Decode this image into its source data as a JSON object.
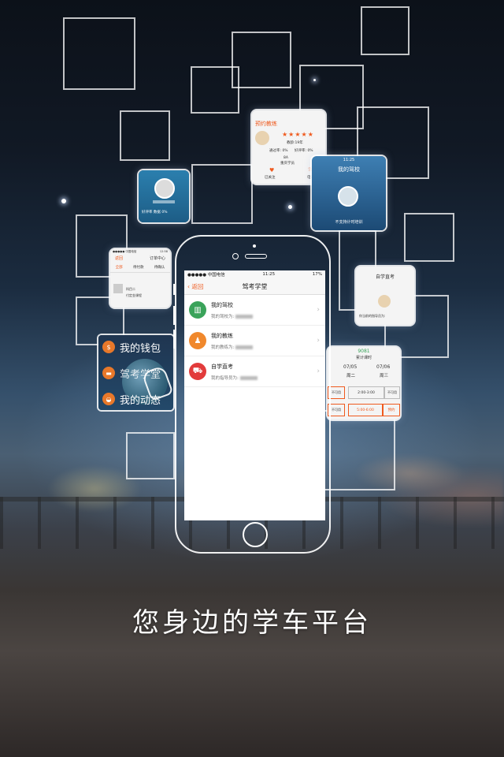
{
  "caption": "您身边的学车平台",
  "phone": {
    "status": {
      "carrier": "●●●●● 中国电信",
      "time": "11:25",
      "battery": "17%"
    },
    "nav": {
      "back_label": "返回",
      "title": "驾考学堂"
    },
    "rows": [
      {
        "title": "我的驾校",
        "sub_label": "我的驾校为:",
        "icon": "bank-icon",
        "color": "#3aa35a"
      },
      {
        "title": "我的教练",
        "sub_label": "我的教练为:",
        "icon": "car-person-icon",
        "color": "#f0882c"
      },
      {
        "title": "自学直考",
        "sub_label": "我的指导员为:",
        "icon": "car-icon",
        "color": "#e23b3b"
      }
    ]
  },
  "wallet_card": {
    "items": [
      "我的钱包",
      "驾考学堂",
      "我的动态"
    ]
  },
  "coach_card": {
    "title": "预约教练",
    "rating": "★★★★★",
    "line1": "教龄:19年",
    "line2a": "通过率: 0%",
    "line2b": "好评率: 0%",
    "plate": "8A",
    "school": "重庆学员",
    "follow": "已关注",
    "call": "电话"
  },
  "school_card": {
    "time": "11:25",
    "title": "我的驾校",
    "notice": "不支持计时培训"
  },
  "order_card": {
    "carrier": "●●●●● 中国电信",
    "time": "12:58",
    "back": "返回",
    "title": "订单中心",
    "tabs": [
      "全部",
      "待付款",
      "待确认"
    ],
    "item_a": "科目二",
    "item_b": "付定金课程"
  },
  "self_card": {
    "title": "自学直考",
    "text": "你当前的指导员为:"
  },
  "schedule_card": {
    "hours": "9081",
    "hours_label": "累计课时",
    "dates": [
      "07/05",
      "07/06"
    ],
    "days": [
      "周二",
      "周三"
    ],
    "slots": [
      "不可用",
      "2:00-3:00",
      "不可用",
      "不可用",
      "5:00-6:00",
      "预约"
    ]
  },
  "profile_card": {
    "stats": "好评率  数据  0%"
  },
  "colors": {
    "accent": "#ef5a1e",
    "green": "#3aa35a",
    "orange": "#f0882c",
    "red": "#e23b3b"
  }
}
